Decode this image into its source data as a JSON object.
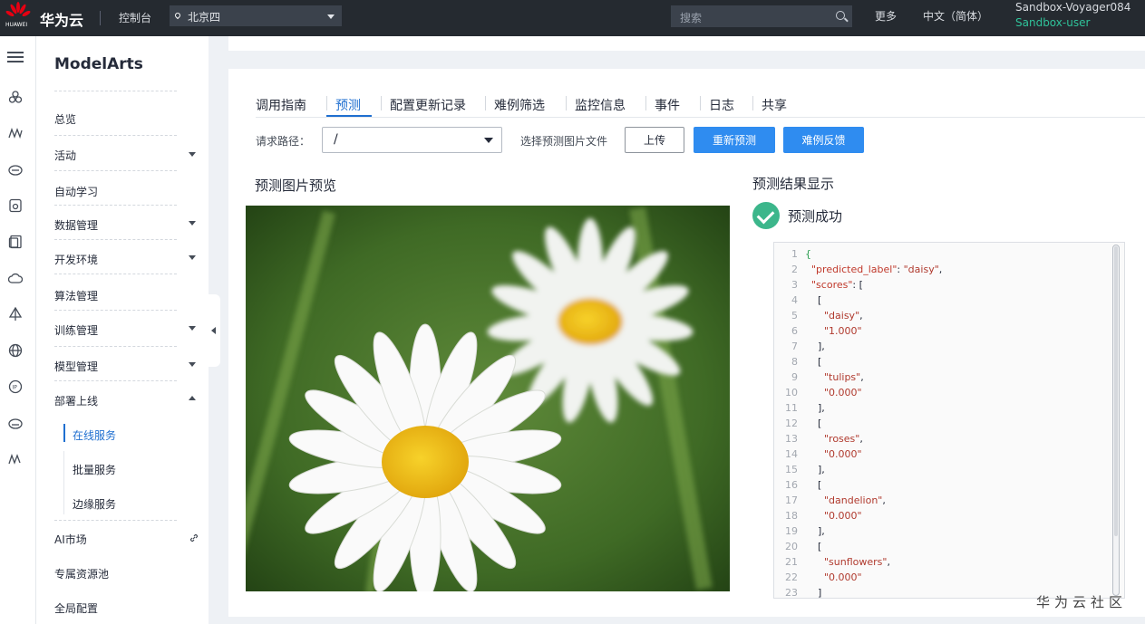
{
  "topbar": {
    "logo_text": "HUAWEI",
    "brand": "华为云",
    "console": "控制台",
    "region": "北京四",
    "search_placeholder": "搜索",
    "more": "更多",
    "language": "中文（简体）",
    "account": "Sandbox-Voyager084",
    "user": "Sandbox-user"
  },
  "sidebar": {
    "title": "ModelArts",
    "items": [
      {
        "label": "总览"
      },
      {
        "label": "活动"
      },
      {
        "label": "自动学习"
      },
      {
        "label": "数据管理"
      },
      {
        "label": "开发环境"
      },
      {
        "label": "算法管理"
      },
      {
        "label": "训练管理"
      },
      {
        "label": "模型管理"
      },
      {
        "label": "部署上线"
      },
      {
        "label": "AI市场"
      },
      {
        "label": "专属资源池"
      },
      {
        "label": "全局配置"
      }
    ],
    "sub_items": [
      {
        "label": "在线服务"
      },
      {
        "label": "批量服务"
      },
      {
        "label": "边缘服务"
      }
    ]
  },
  "tabs": [
    "调用指南",
    "预测",
    "配置更新记录",
    "难例筛选",
    "监控信息",
    "事件",
    "日志",
    "共享"
  ],
  "active_tab": "预测",
  "request": {
    "path_label": "请求路径：",
    "path_value": "/",
    "file_label": "选择预测图片文件",
    "upload_button": "上传",
    "repredict_button": "重新预测",
    "hard_example_button": "难例反馈"
  },
  "preview": {
    "title": "预测图片预览"
  },
  "result": {
    "title": "预测结果显示",
    "status": "预测成功",
    "code_lines": [
      "{",
      "  \"predicted_label\": \"daisy\",",
      "  \"scores\": [",
      "    [",
      "      \"daisy\",",
      "      \"1.000\"",
      "    ],",
      "    [",
      "      \"tulips\",",
      "      \"0.000\"",
      "    ],",
      "    [",
      "      \"roses\",",
      "      \"0.000\"",
      "    ],",
      "    [",
      "      \"dandelion\",",
      "      \"0.000\"",
      "    ],",
      "    [",
      "      \"sunflowers\",",
      "      \"0.000\"",
      "    ]"
    ]
  },
  "watermark": "华为云社区",
  "colors": {
    "accent": "#1f6fd0",
    "primary_button": "#2f8cf0",
    "success": "#3cb68b",
    "topbar": "#252a30",
    "user_green": "#2fc39a"
  }
}
